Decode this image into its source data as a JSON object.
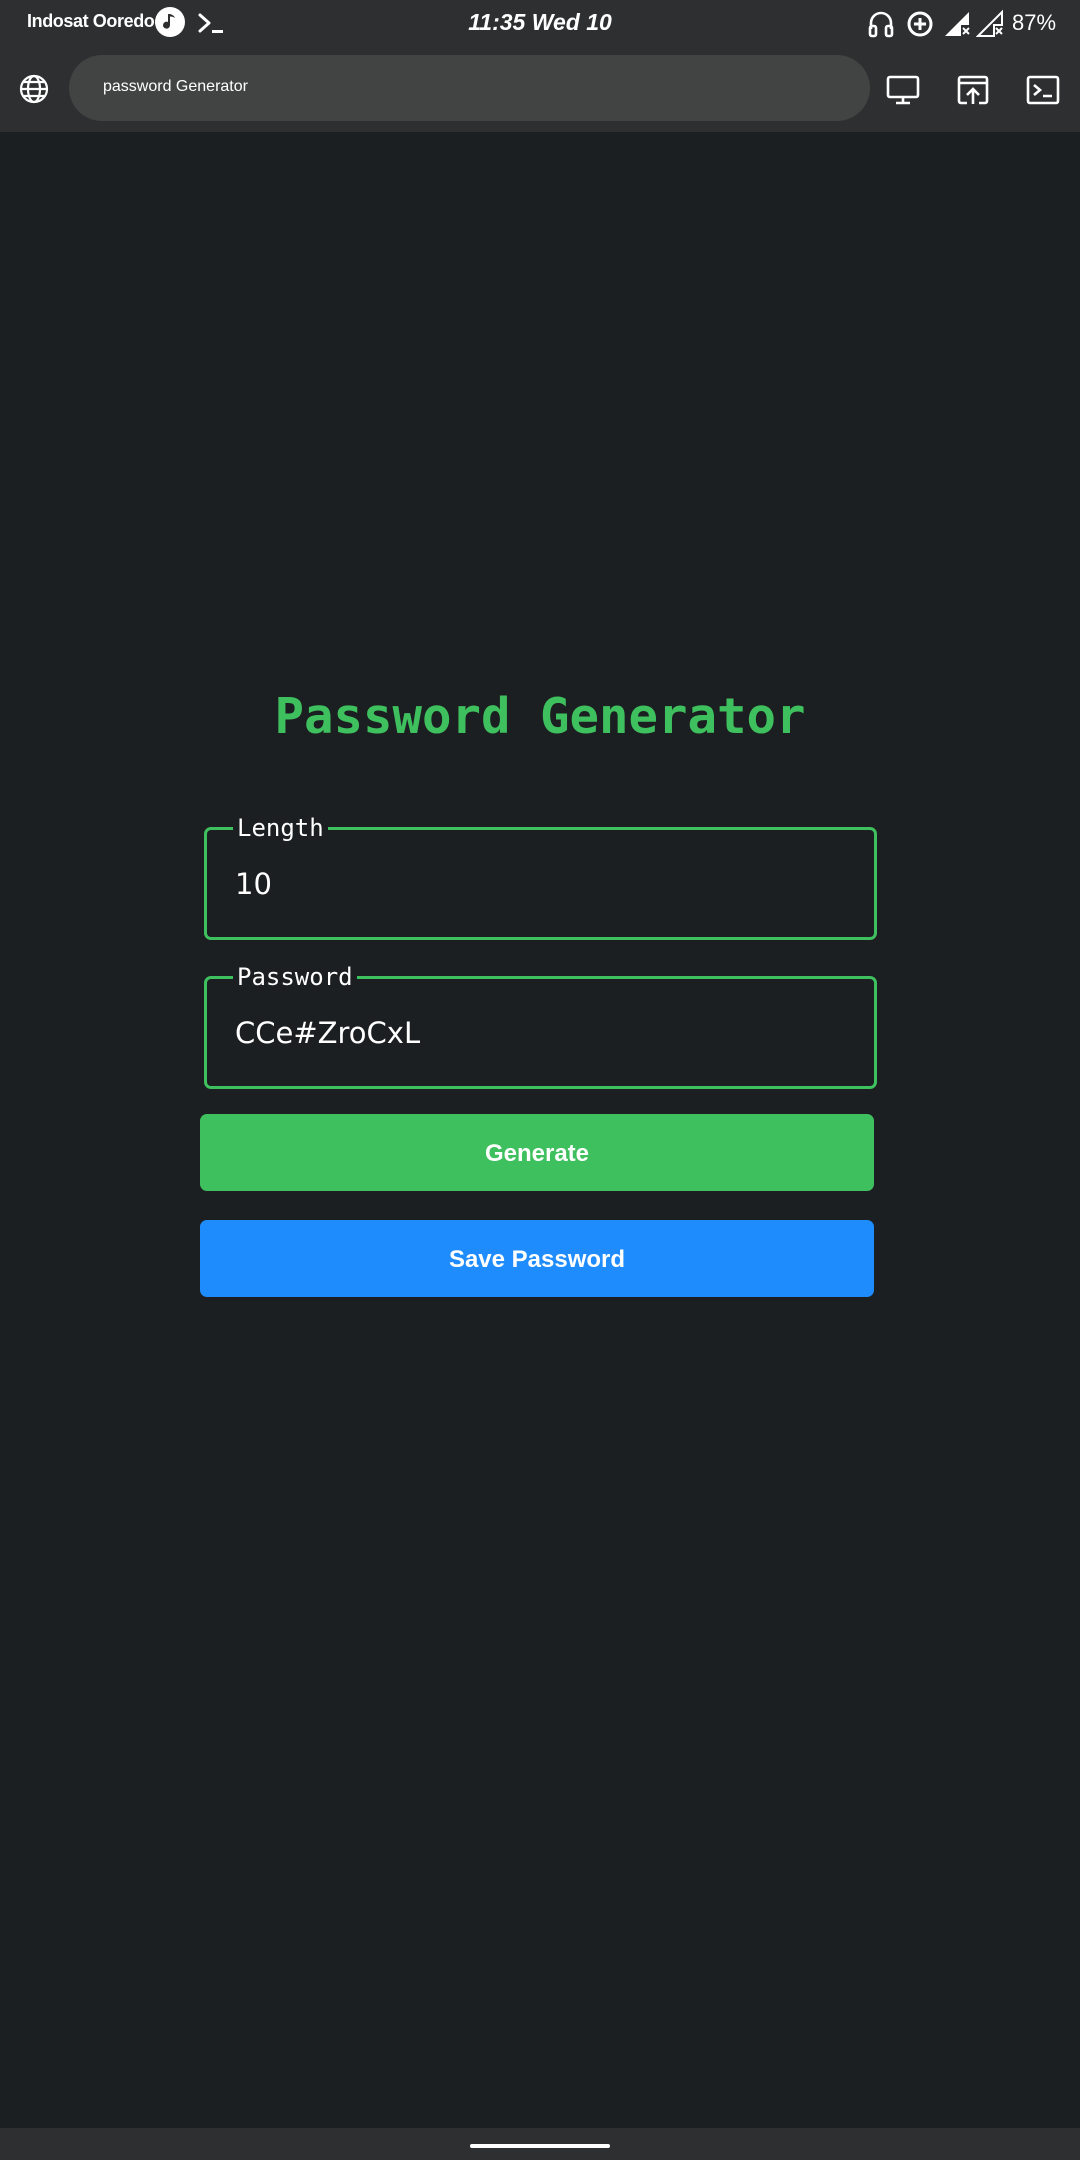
{
  "status_bar": {
    "carrier": "Indosat Ooredoo",
    "time": "11:35 Wed 10",
    "battery": "87%"
  },
  "toolbar": {
    "url": "password Generator"
  },
  "app": {
    "title": "Password Generator",
    "length_label": "Length",
    "length_value": "10",
    "password_label": "Password",
    "password_value": "CCe#ZroCxL",
    "generate_label": "Generate",
    "save_label": "Save Password"
  },
  "colors": {
    "background": "#1c1f21",
    "bar": "#2e2f30",
    "accent_green": "#3fc05e",
    "accent_blue": "#1e8cfc"
  },
  "icons": [
    "music-icon",
    "terminal-icon",
    "headphones-icon",
    "data-saver-icon",
    "signal-icon",
    "globe-icon",
    "desktop-icon",
    "open-in-app-icon"
  ]
}
